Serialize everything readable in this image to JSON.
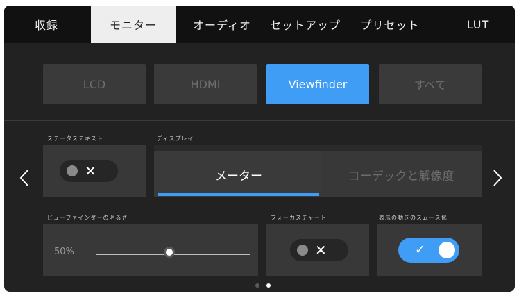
{
  "tabs": [
    {
      "label": "収録",
      "active": false
    },
    {
      "label": "モニター",
      "active": true
    },
    {
      "label": "オーディオ",
      "active": false
    },
    {
      "label": "セットアップ",
      "active": false
    },
    {
      "label": "プリセット",
      "active": false
    },
    {
      "label": "LUT",
      "active": false
    }
  ],
  "sources": [
    {
      "label": "LCD",
      "active": false
    },
    {
      "label": "HDMI",
      "active": false
    },
    {
      "label": "Viewfinder",
      "active": true
    },
    {
      "label": "すべて",
      "active": false
    }
  ],
  "status_text": {
    "label": "ステータステキスト",
    "toggle_mark": "✕",
    "enabled": false
  },
  "display": {
    "label": "ディスプレイ",
    "options": [
      {
        "label": "メーター",
        "selected": true
      },
      {
        "label": "コーデックと解像度",
        "selected": false
      }
    ]
  },
  "brightness": {
    "label": "ビューファインダーの明るさ",
    "value_text": "50%",
    "value": 50
  },
  "focus_chart": {
    "label": "フォーカスチャート",
    "toggle_mark": "✕",
    "enabled": false
  },
  "smooth_motion": {
    "label": "表示の動きのスムース化",
    "toggle_mark": "✓",
    "enabled": true
  },
  "pagination": {
    "pages": 2,
    "current": 2
  },
  "colors": {
    "accent": "#3f9df5",
    "background": "#222222"
  },
  "icons": {
    "prev": "chevron-left-icon",
    "next": "chevron-right-icon"
  }
}
